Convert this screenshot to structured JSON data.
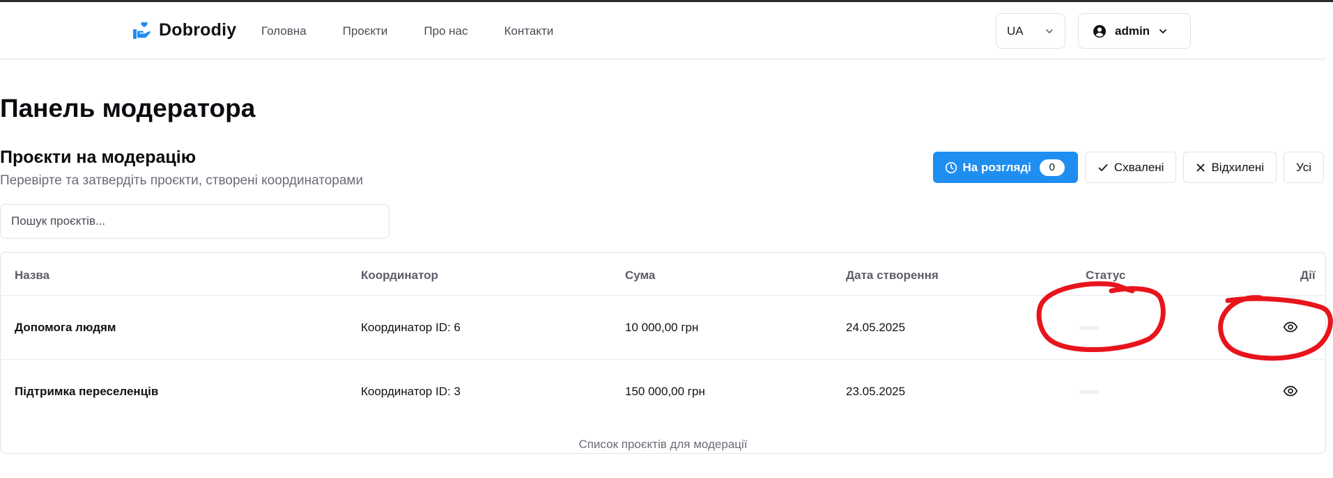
{
  "nav": {
    "brand": "Dobrodiy",
    "links": [
      "Головна",
      "Проєкти",
      "Про нас",
      "Контакти"
    ],
    "language": "UA",
    "user": "admin"
  },
  "page": {
    "title": "Панель модератора",
    "section_title": "Проєкти на модерацію",
    "section_subtitle": "Перевірте та затвердіть проєкти, створені координаторами"
  },
  "filters": {
    "pending": "На розгляді",
    "pending_count": "0",
    "approved": "Схвалені",
    "rejected": "Відхилені",
    "all": "Усі"
  },
  "search": {
    "placeholder": "Пошук проєктів..."
  },
  "table": {
    "headers": {
      "name": "Назва",
      "coordinator": "Координатор",
      "amount": "Сума",
      "created": "Дата створення",
      "status": "Статус",
      "actions": "Дії"
    },
    "rows": [
      {
        "name": "Допомога людям",
        "coordinator": "Координатор ID: 6",
        "amount": "10 000,00 грн",
        "created": "24.05.2025"
      },
      {
        "name": "Підтримка переселенців",
        "coordinator": "Координатор ID: 3",
        "amount": "150 000,00 грн",
        "created": "23.05.2025"
      }
    ],
    "caption": "Список проєктів для модерації"
  },
  "colors": {
    "accent": "#1f8ef1",
    "annotation": "#e8141b"
  }
}
